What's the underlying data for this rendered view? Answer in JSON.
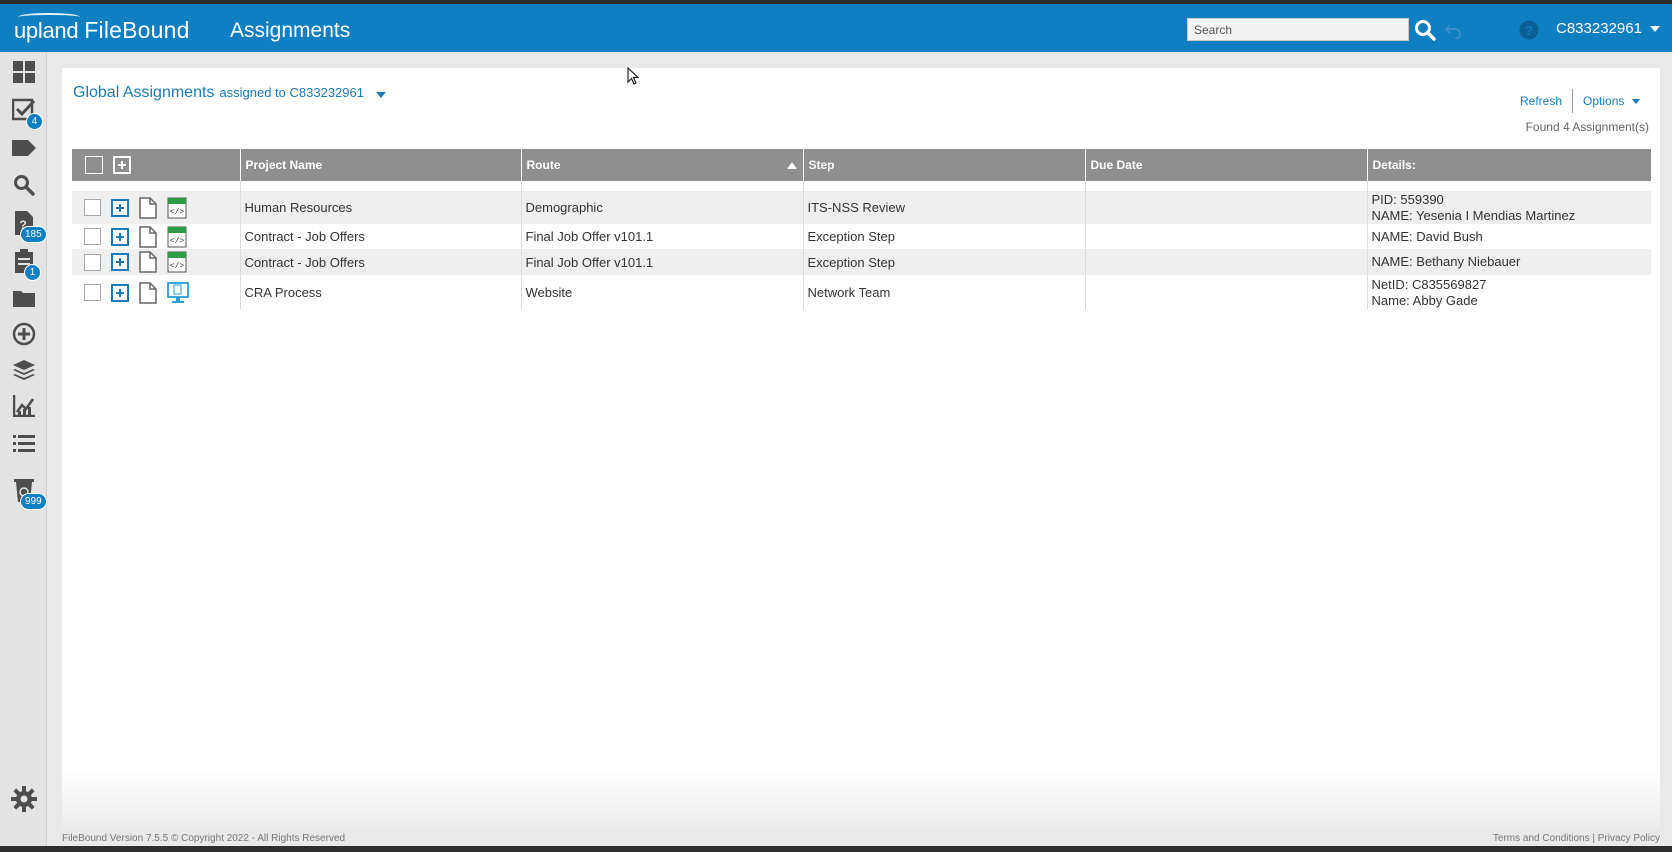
{
  "app": {
    "brand_prefix": "upland",
    "brand_name": "FileBound",
    "page_heading": "Assignments",
    "accent_color": "#0f7fc1"
  },
  "header": {
    "search_placeholder": "Search",
    "search_icon": "search-icon",
    "undo_icon": "undo-icon",
    "help_icon": "help-icon",
    "user_id": "C833232961"
  },
  "sidebar": {
    "items": [
      {
        "icon": "dashboard-icon"
      },
      {
        "icon": "assignments-check-icon",
        "badge": "4"
      },
      {
        "icon": "tag-icon"
      },
      {
        "icon": "search-icon"
      },
      {
        "icon": "document-question-icon",
        "badge": "185"
      },
      {
        "icon": "clipboard-icon",
        "badge": "1"
      },
      {
        "icon": "folder-icon"
      },
      {
        "icon": "add-circle-icon"
      },
      {
        "icon": "layers-icon"
      },
      {
        "icon": "reports-chart-icon"
      },
      {
        "icon": "list-icon"
      },
      {
        "icon": "recycle-bin-icon",
        "badge": "999"
      },
      {
        "icon": "gear-icon"
      }
    ]
  },
  "main": {
    "title": "Global Assignments",
    "assigned_to": "assigned to C833232961",
    "refresh_label": "Refresh",
    "options_label": "Options",
    "found_count": "Found 4 Assignment(s)",
    "columns": [
      "Project Name",
      "Route",
      "Step",
      "Due Date",
      "Details:"
    ],
    "sorted_column": "Route",
    "rows": [
      {
        "project": "Human Resources",
        "route": "Demographic",
        "step": "ITS-NSS Review",
        "due": "",
        "details": [
          "PID: 559390",
          "NAME: Yesenia I Mendias Martinez"
        ],
        "type_icon": "html-form-icon"
      },
      {
        "project": "Contract - Job Offers",
        "route": "Final Job Offer v101.1",
        "step": "Exception Step",
        "due": "",
        "details": [
          "NAME: David Bush"
        ],
        "type_icon": "html-form-icon"
      },
      {
        "project": "Contract - Job Offers",
        "route": "Final Job Offer v101.1",
        "step": "Exception Step",
        "due": "",
        "details": [
          "NAME: Bethany Niebauer"
        ],
        "type_icon": "html-form-icon"
      },
      {
        "project": "CRA Process",
        "route": "Website",
        "step": "Network Team",
        "due": "",
        "details": [
          "NetID: C835569827",
          "Name: Abby Gade"
        ],
        "type_icon": "monitor-document-icon"
      }
    ]
  },
  "footer": {
    "version": "FileBound Version 7.5.5 © Copyright 2022 - All Rights Reserved",
    "links": "Terms and Conditions | Privacy Policy"
  }
}
